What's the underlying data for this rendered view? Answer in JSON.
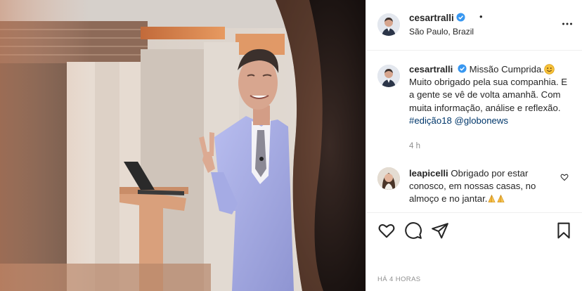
{
  "post": {
    "username": "cesartralli",
    "header_dot": "•",
    "location": "São Paulo, Brazil",
    "caption_username": "cesartralli",
    "caption_text_1": "Missão Cumprida.",
    "caption_text_2": "Muito obrigado pela sua companhia. E a gente se vê de volta amanhã. Com muita informação, análise e reflexão.",
    "hashtag": "#edição18",
    "mention": "@globonews",
    "caption_time": "4 h",
    "timestamp": "HÁ 4 HORAS"
  },
  "comment": {
    "username": "leapicelli",
    "text": "Obrigado por estar conosco, em nossas casas, no almoço e no jantar."
  },
  "icons": {
    "verified": "verified-badge-icon",
    "more": "more-options-icon",
    "like": "heart-icon",
    "comment": "comment-icon",
    "share": "share-icon",
    "save": "bookmark-icon",
    "caption_emoji": "smiling-face-emoji",
    "comment_emoji": "folded-hands-emoji"
  },
  "colors": {
    "verified_blue": "#3897f0",
    "link_blue": "#00376b",
    "secondary_text": "#8e8e8e",
    "suit_lavender": "#a9b0e6"
  }
}
